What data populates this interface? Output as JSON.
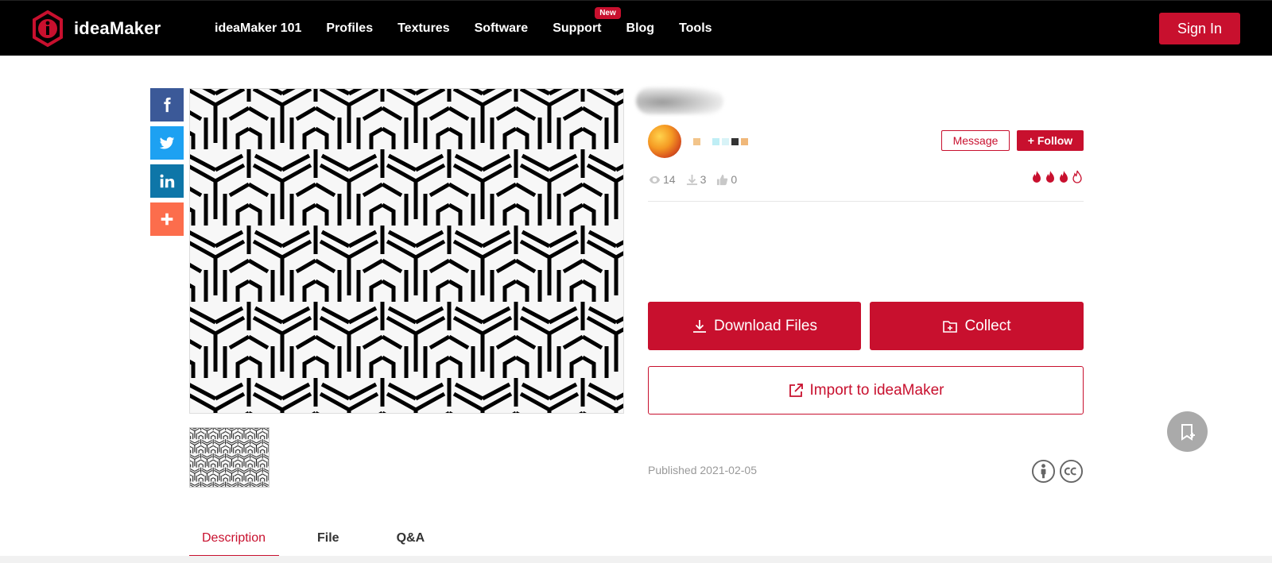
{
  "brand": {
    "name": "ideaMaker",
    "accent": "#c8102e"
  },
  "nav": {
    "items": [
      {
        "label": "ideaMaker 101"
      },
      {
        "label": "Profiles"
      },
      {
        "label": "Textures"
      },
      {
        "label": "Software"
      },
      {
        "label": "Support",
        "badge": "New"
      },
      {
        "label": "Blog"
      },
      {
        "label": "Tools"
      }
    ],
    "sign_in": "Sign In"
  },
  "share": {
    "items": [
      "facebook-icon",
      "twitter-icon",
      "linkedin-icon",
      "plus-icon"
    ]
  },
  "author": {
    "message_label": "Message",
    "follow_label": "+ Follow"
  },
  "stats": {
    "views": "14",
    "downloads": "3",
    "likes": "0",
    "heat_level": 3,
    "heat_max": 4
  },
  "actions": {
    "download_label": "Download Files",
    "collect_label": "Collect",
    "import_label": "Import to ideaMaker"
  },
  "meta": {
    "published": "Published 2021-02-05"
  },
  "tabs": [
    {
      "label": "Description"
    },
    {
      "label": "File"
    },
    {
      "label": "Q&A"
    }
  ]
}
